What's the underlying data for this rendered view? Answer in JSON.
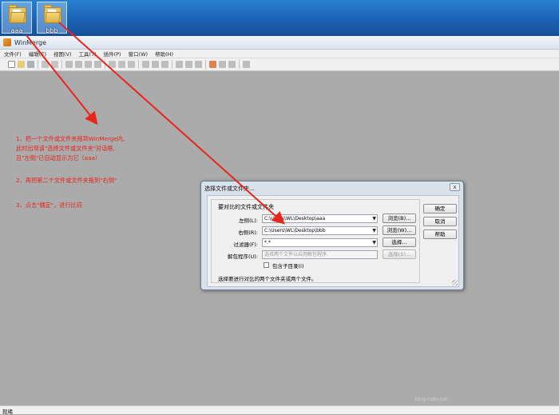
{
  "desktop": {
    "icons": [
      {
        "label": "aaa"
      },
      {
        "label": "bbb"
      }
    ]
  },
  "window": {
    "title": "WinMerge"
  },
  "menu": {
    "items": [
      "文件(F)",
      "编辑(E)",
      "视图(V)",
      "工具(T)",
      "插件(P)",
      "窗口(W)",
      "帮助(H)"
    ]
  },
  "annotations": {
    "step1_line1": "1、把一个文件或文件夹拖到WinMerge内,",
    "step1_line2": "此时出现该\"选择文件或文件夹\"对话框,",
    "step1_line3": "且\"左侧\"已自动显示为它（aaa）",
    "step2": "2、再把第二个文件或文件夹拖到\"右侧\"",
    "step3": "3、点击\"确定\"，进行比较"
  },
  "dialog": {
    "title": "选择文件或文件夹...",
    "close": "x",
    "group_label": "要对比的文件或文件夹",
    "left_label": "左侧(L):",
    "left_value": "C:\\Users\\WL\\Desktop\\aaa",
    "left_browse": "浏览(B)...",
    "right_label": "右侧(R):",
    "right_value": "C:\\Users\\WL\\Desktop\\bbb",
    "right_browse": "浏览(W)...",
    "filter_label": "过滤器(F):",
    "filter_value": "*.*",
    "filter_select": "选择...",
    "unpacker_label": "解包程序(U):",
    "unpacker_value": "选择两个文件以启用解包程序.",
    "unpacker_select": "选择(S)...",
    "subfolders_label": "包含子目录(I)",
    "subfolders_checked": false,
    "status_text": "选择要进行对比的两个文件夹或两个文件。",
    "ok": "确定",
    "cancel": "取消",
    "help": "帮助"
  },
  "statusbar": {
    "text": "就绪"
  },
  "colors": {
    "annotation": "#e8251c",
    "workspace": "#ababab",
    "desktop": "#1b62b4"
  }
}
